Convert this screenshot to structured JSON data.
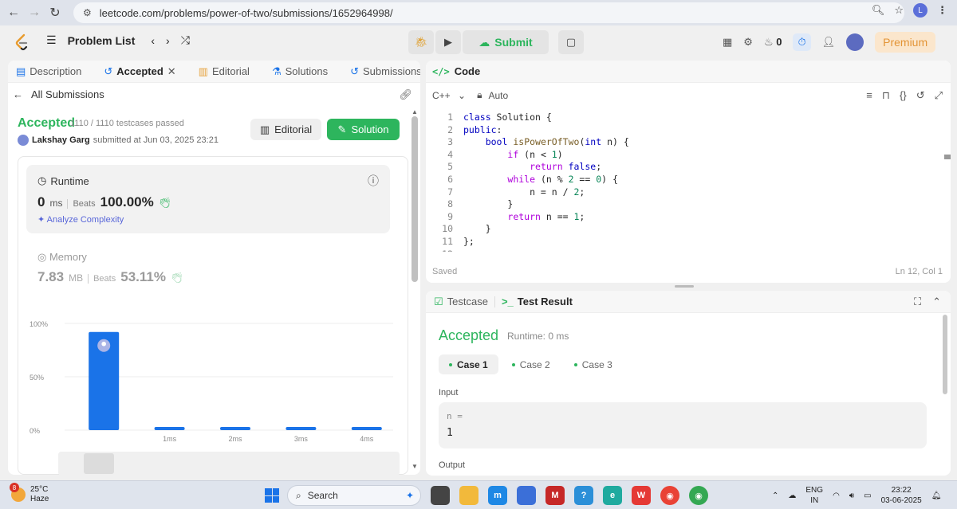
{
  "browser": {
    "url": "leetcode.com/problems/power-of-two/submissions/1652964998/",
    "profile_initial": "L"
  },
  "nav": {
    "problem_list": "Problem List",
    "submit": "Submit",
    "streak_count": "0",
    "premium": "Premium"
  },
  "left_tabs": [
    {
      "label": "Description"
    },
    {
      "label": "Accepted"
    },
    {
      "label": "Editorial"
    },
    {
      "label": "Solutions"
    },
    {
      "label": "Submissions"
    }
  ],
  "submission": {
    "all_submissions": "All Submissions",
    "status": "Accepted",
    "testcases": "1110 / 1110 testcases passed",
    "user": "Lakshay Garg",
    "submitted_at": "submitted at Jun 03, 2025 23:21",
    "editorial_btn": "Editorial",
    "solution_btn": "Solution"
  },
  "runtime": {
    "label": "Runtime",
    "value": "0",
    "unit": "ms",
    "beats_label": "Beats",
    "beats_value": "100.00%",
    "analyze": "Analyze Complexity"
  },
  "memory": {
    "label": "Memory",
    "value": "7.83",
    "unit": "MB",
    "beats_label": "Beats",
    "beats_value": "53.11%"
  },
  "chart_data": {
    "type": "bar",
    "categories": [
      "",
      "1ms",
      "2ms",
      "3ms",
      "4ms"
    ],
    "values": [
      92,
      3,
      3,
      3,
      3
    ],
    "ylim": [
      0,
      100
    ],
    "y_ticks": [
      "100%",
      "50%",
      "0%"
    ],
    "highlight_index": 0,
    "bar_color": "#1a73e8"
  },
  "code_panel": {
    "title": "Code",
    "language": "C++",
    "mode": "Auto",
    "status": "Saved",
    "position": "Ln 12, Col 1",
    "lines": [
      "class Solution {",
      "public:",
      "    bool isPowerOfTwo(int n) {",
      "        if (n < 1)",
      "            return false;",
      "        while (n % 2 == 0) {",
      "            n = n / 2;",
      "        }",
      "        return n == 1;",
      "    }",
      "};",
      ""
    ]
  },
  "test_panel": {
    "testcase_tab": "Testcase",
    "result_tab": "Test Result",
    "status": "Accepted",
    "runtime": "Runtime: 0 ms",
    "cases": [
      "Case 1",
      "Case 2",
      "Case 3"
    ],
    "input_label": "Input",
    "var_name": "n =",
    "var_value": "1",
    "output_label": "Output"
  },
  "taskbar": {
    "weather_badge": "8",
    "temp": "25°C",
    "condition": "Haze",
    "search": "Search",
    "lang_top": "ENG",
    "lang_bottom": "IN",
    "time": "23:22",
    "date": "03-06-2025"
  },
  "colors": {
    "accent_green": "#2db55d",
    "accent_blue": "#1a73e8",
    "premium": "#e39436"
  }
}
